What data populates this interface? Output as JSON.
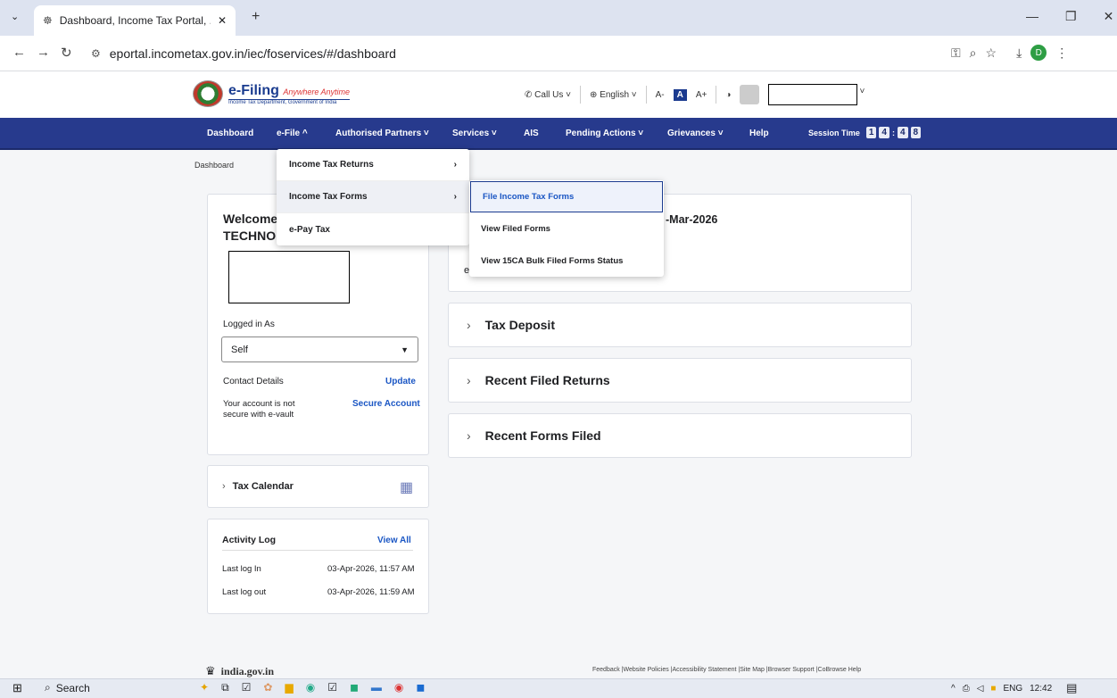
{
  "browser": {
    "tab_title": "Dashboard, Income Tax Portal, ...",
    "url": "eportal.incometax.gov.in/iec/foservices/#/dashboard",
    "new_tab": "+",
    "profile_initial": "D"
  },
  "header": {
    "logo_title": "e-Filing",
    "logo_tagline": "Anywhere Anytime",
    "logo_sub": "Income Tax Department, Government of India",
    "call_us": "Call Us",
    "language": "English",
    "font_small": "A-",
    "font_normal": "A",
    "font_large": "A+"
  },
  "nav": {
    "items": [
      "Dashboard",
      "e-File ^",
      "Authorised Partners ˅",
      "Services ˅",
      "AIS",
      "Pending Actions ˅",
      "Grievances ˅",
      "Help"
    ],
    "session_label": "Session Time",
    "session_digits": [
      "1",
      "4",
      ":",
      "4",
      "8"
    ]
  },
  "breadcrumb": "Dashboard",
  "efile_menu": {
    "items": [
      "Income Tax Returns",
      "Income Tax Forms",
      "e-Pay Tax"
    ]
  },
  "forms_submenu": {
    "items": [
      "File Income Tax Forms",
      "View Filed Forms",
      "View 15CA Bulk Filed Forms Status"
    ]
  },
  "profile_card": {
    "welcome": "Welcome",
    "company": "TECHNOL",
    "logged_in_as_label": "Logged in As",
    "logged_in_as_value": "Self",
    "contact_label": "Contact Details",
    "update_link": "Update",
    "security_note": "Your account is not secure with e-vault",
    "secure_link": "Secure Account"
  },
  "tax_calendar": {
    "label": "Tax Calendar"
  },
  "activity_log": {
    "title": "Activity Log",
    "view_all": "View All",
    "rows": [
      {
        "label": "Last log In",
        "value": "03-Apr-2026, 11:57 AM"
      },
      {
        "label": "Last log out",
        "value": "03-Apr-2026, 11:59 AM"
      }
    ]
  },
  "main_card": {
    "date_fragment": "-Mar-2026",
    "text_fragment": "e"
  },
  "accordions": [
    "Tax Deposit",
    "Recent Filed Returns",
    "Recent Forms Filed"
  ],
  "footer": {
    "gov_logo": "india.gov.in",
    "links": "Feedback |Website Policies |Accessibility Statement |Site Map |Browser Support |CoBrowse Help"
  },
  "taskbar": {
    "search": "Search",
    "lang": "ENG",
    "time": "12:42"
  }
}
